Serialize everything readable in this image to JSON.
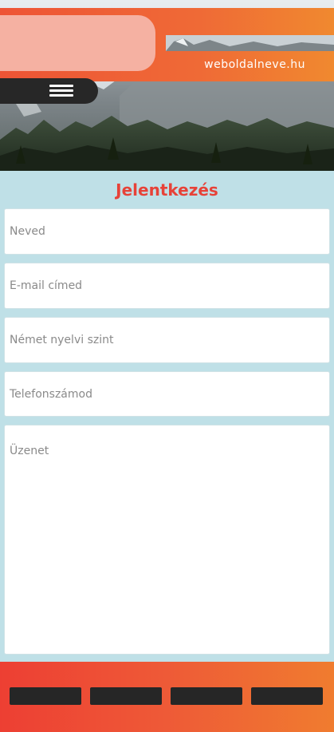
{
  "header": {
    "site_name": "weboldalneve.hu",
    "menu_icon": "hamburger-menu-icon"
  },
  "form": {
    "title": "Jelentkezés",
    "fields": [
      {
        "placeholder": "Neved"
      },
      {
        "placeholder": "E-mail címed"
      },
      {
        "placeholder": "Német nyelvi szint"
      },
      {
        "placeholder": "Telefonszámod"
      },
      {
        "placeholder": "Üzenet"
      }
    ]
  },
  "colors": {
    "accent_orange": "#ee5435",
    "title_red": "#e74238",
    "form_background": "#bfe0e7",
    "footer_button": "#262626"
  }
}
